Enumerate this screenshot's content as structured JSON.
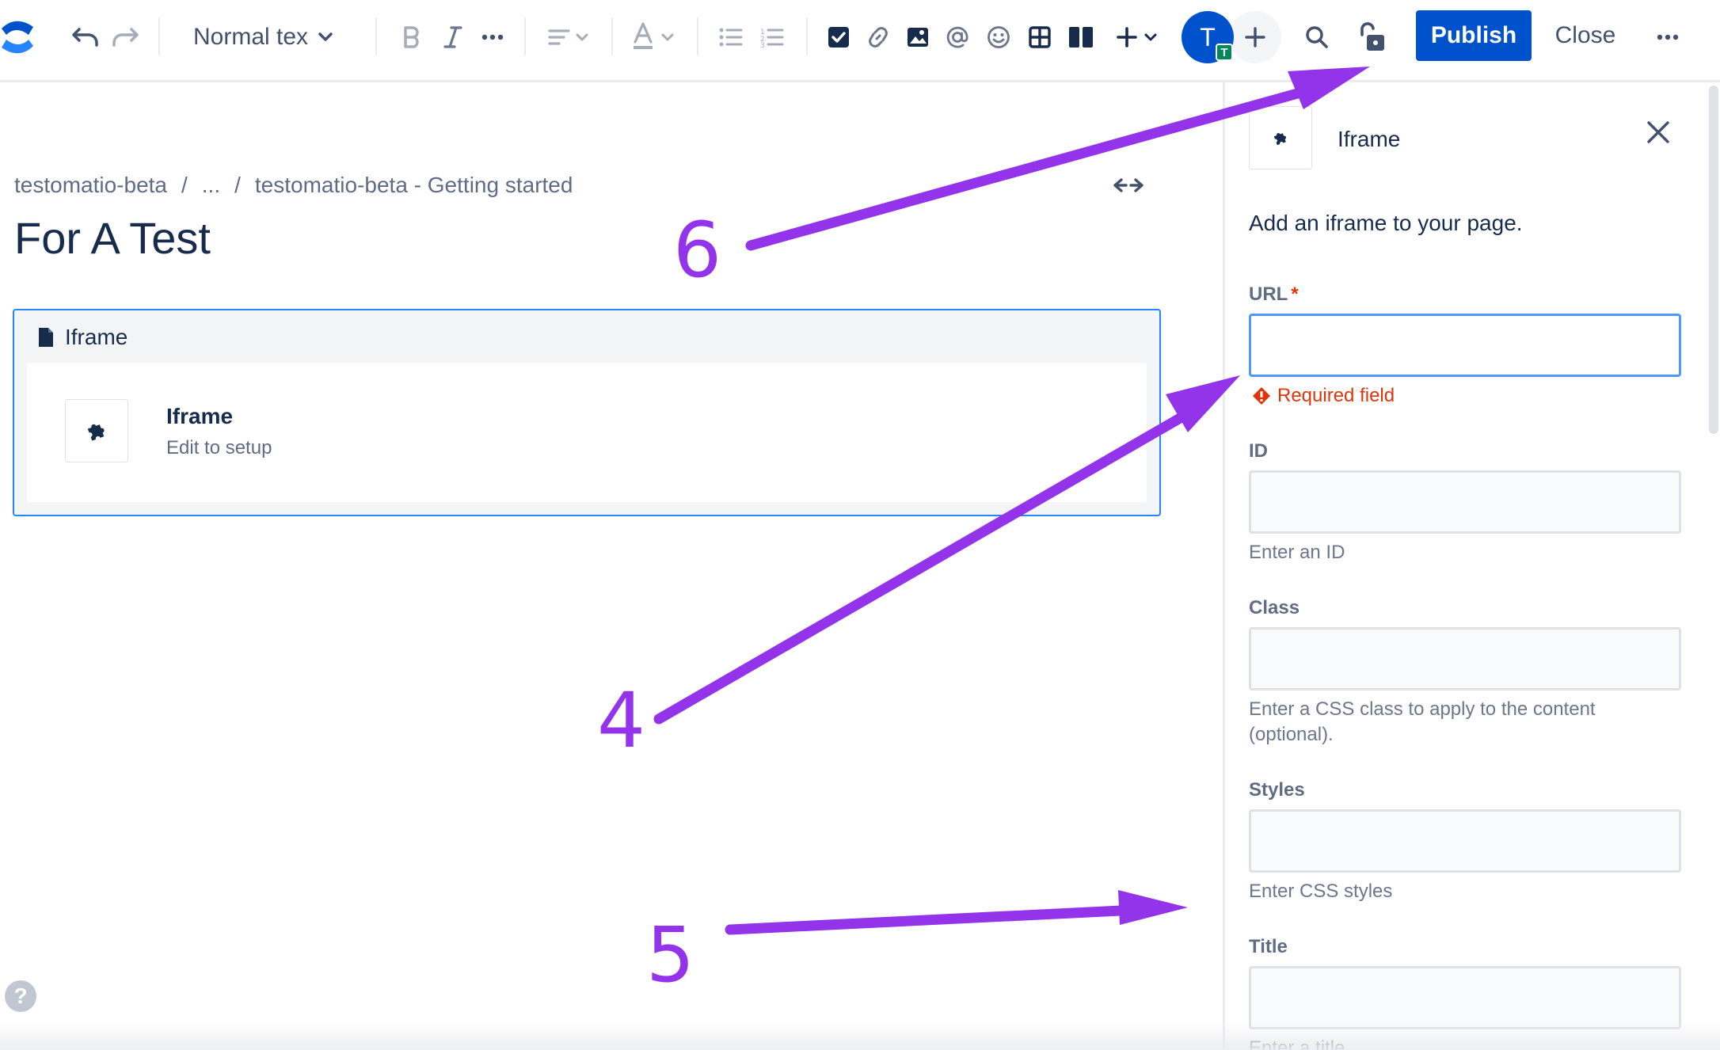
{
  "toolbar": {
    "text_style": "Normal tex",
    "avatar_initial": "T",
    "avatar_badge": "T",
    "publish_label": "Publish",
    "close_label": "Close",
    "icons": [
      "confluence-logo-icon",
      "undo-icon",
      "redo-icon",
      "chevron-down-icon",
      "bold-icon",
      "italic-icon",
      "more-formatting-icon",
      "align-icon",
      "text-color-icon",
      "bullet-list-icon",
      "numbered-list-icon",
      "checkbox-icon",
      "link-icon",
      "image-icon",
      "mention-icon",
      "emoji-icon",
      "table-icon",
      "layout-icon",
      "insert-plus-icon",
      "add-collaborator-icon",
      "search-icon",
      "restrictions-lock-icon",
      "more-actions-icon"
    ]
  },
  "breadcrumb": {
    "items": [
      "testomatio-beta",
      "...",
      "testomatio-beta - Getting started"
    ],
    "separator": "/"
  },
  "page": {
    "title": "For A Test"
  },
  "macro": {
    "header": "Iframe",
    "title": "Iframe",
    "subtitle": "Edit to setup"
  },
  "panel": {
    "title": "Iframe",
    "description": "Add an iframe to your page.",
    "fields": {
      "url": {
        "label": "URL",
        "required_mark": "*",
        "value": "",
        "error": "Required field"
      },
      "id": {
        "label": "ID",
        "value": "",
        "help": "Enter an ID"
      },
      "class": {
        "label": "Class",
        "value": "",
        "help": "Enter a CSS class to apply to the content (optional)."
      },
      "styles": {
        "label": "Styles",
        "value": "",
        "help": "Enter CSS styles"
      },
      "title": {
        "label": "Title",
        "value": "",
        "help": "Enter a title"
      }
    }
  },
  "help": {
    "label": "?"
  },
  "annotations": {
    "color": "#9333ea",
    "labels": [
      "6",
      "4",
      "5"
    ]
  }
}
